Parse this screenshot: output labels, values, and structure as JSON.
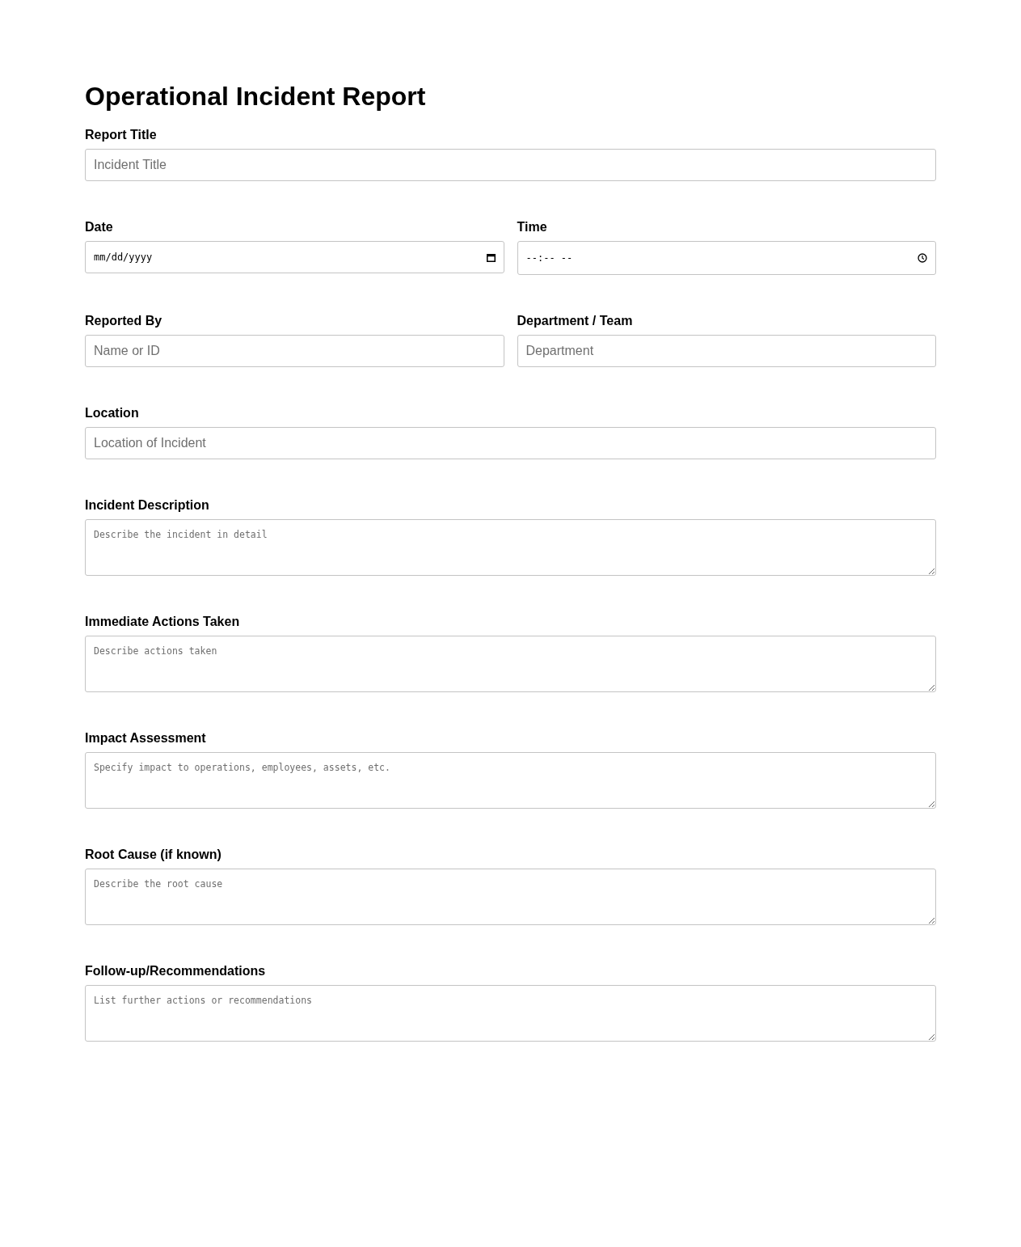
{
  "title": "Operational Incident Report",
  "rows": [
    {
      "fields": [
        {
          "kind": "text",
          "label": "Report Title",
          "placeholder": "Incident Title"
        }
      ]
    },
    {
      "fields": [
        {
          "kind": "date",
          "label": "Date",
          "value": "mm/dd/yyyy"
        },
        {
          "kind": "time",
          "label": "Time",
          "value": "--:-- --"
        }
      ]
    },
    {
      "fields": [
        {
          "kind": "text",
          "label": "Reported By",
          "placeholder": "Name or ID"
        },
        {
          "kind": "text",
          "label": "Department / Team",
          "placeholder": "Department"
        }
      ]
    },
    {
      "fields": [
        {
          "kind": "text",
          "label": "Location",
          "placeholder": "Location of Incident"
        }
      ]
    },
    {
      "fields": [
        {
          "kind": "textarea",
          "label": "Incident Description",
          "placeholder": "Describe the incident in detail"
        }
      ]
    },
    {
      "fields": [
        {
          "kind": "textarea",
          "label": "Immediate Actions Taken",
          "placeholder": "Describe actions taken"
        }
      ]
    },
    {
      "fields": [
        {
          "kind": "textarea",
          "label": "Impact Assessment",
          "placeholder": "Specify impact to operations, employees, assets, etc."
        }
      ]
    },
    {
      "fields": [
        {
          "kind": "textarea",
          "label": "Root Cause (if known)",
          "placeholder": "Describe the root cause"
        }
      ]
    },
    {
      "fields": [
        {
          "kind": "textarea",
          "label": "Follow-up/Recommendations",
          "placeholder": "List further actions or recommendations"
        }
      ]
    }
  ]
}
